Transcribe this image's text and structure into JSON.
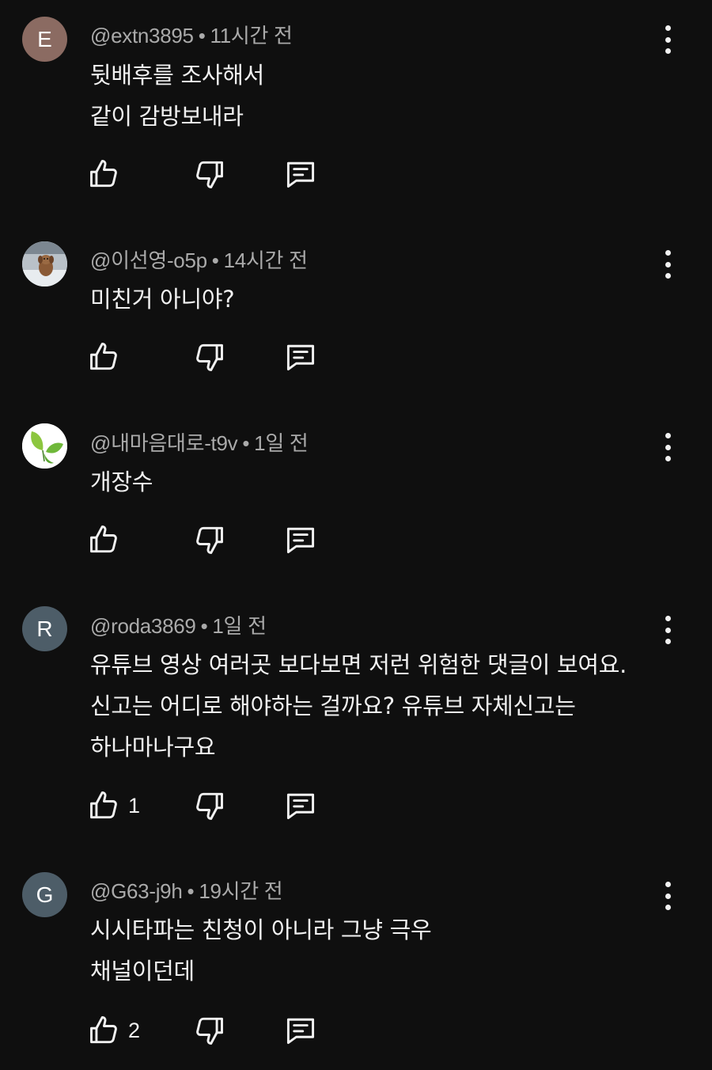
{
  "comments": [
    {
      "avatar": {
        "type": "letter",
        "letter": "E",
        "color": "#8b6b62"
      },
      "handle": "@extn3895",
      "time": "11시간 전",
      "lines": [
        "뒷배후를 조사해서",
        "같이 감방보내라"
      ],
      "likes": ""
    },
    {
      "avatar": {
        "type": "photo",
        "icon": "dog-photo-avatar"
      },
      "handle": "@이선영-o5p",
      "time": "14시간 전",
      "lines": [
        "미친거 아니야?"
      ],
      "likes": ""
    },
    {
      "avatar": {
        "type": "photo",
        "icon": "leaf-photo-avatar"
      },
      "handle": "@내마음대로-t9v",
      "time": "1일 전",
      "lines": [
        "개장수"
      ],
      "likes": ""
    },
    {
      "avatar": {
        "type": "letter",
        "letter": "R",
        "color": "#4d5d68"
      },
      "handle": "@roda3869",
      "time": "1일 전",
      "lines": [
        "유튜브 영상 여러곳 보다보면 저런 위험한 댓글이 보여요.",
        "신고는 어디로 해야하는 걸까요? 유튜브 자체신고는",
        "하나마나구요"
      ],
      "likes": "1"
    },
    {
      "avatar": {
        "type": "letter",
        "letter": "G",
        "color": "#4d5d68"
      },
      "handle": "@G63-j9h",
      "time": "19시간 전",
      "lines": [
        "시시타파는 친청이 아니라 그냥 극우",
        "채널이던데"
      ],
      "likes": "2"
    }
  ],
  "separator": "•",
  "icons": {
    "like": "thumb-up-icon",
    "dislike": "thumb-down-icon",
    "reply": "reply-comment-icon",
    "menu": "more-vert-icon"
  }
}
